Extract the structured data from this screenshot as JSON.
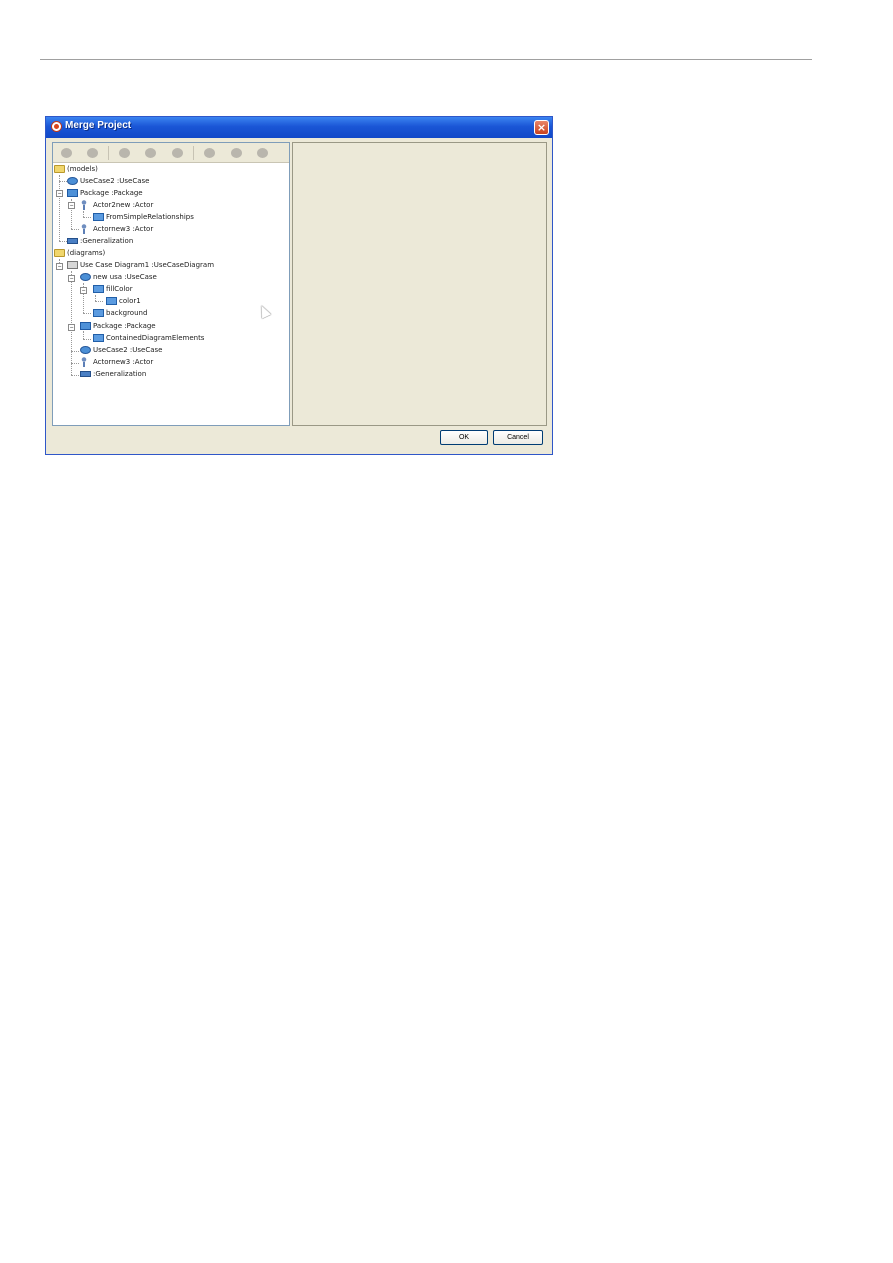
{
  "window": {
    "title": "Merge Project",
    "close_label": "×"
  },
  "toolbar": {
    "icons": [
      "merge-left-icon",
      "merge-right-icon",
      "accept-icon",
      "reject-icon",
      "skip-icon",
      "expand-icon",
      "collapse-icon",
      "refresh-icon"
    ]
  },
  "tree": {
    "nodes": [
      {
        "label": "(models)",
        "icon": "folder-icon"
      },
      {
        "label": "UseCase2 :UseCase",
        "icon": "usecase-icon"
      },
      {
        "label": "Package :Package",
        "icon": "package-icon"
      },
      {
        "label": "Actor2new :Actor",
        "icon": "actor-icon"
      },
      {
        "label": "FromSimpleRelationships",
        "icon": "property-icon"
      },
      {
        "label": "Actornew3 :Actor",
        "icon": "actor-icon"
      },
      {
        "label": ":Generalization",
        "icon": "generalization-icon"
      },
      {
        "label": "(diagrams)",
        "icon": "folder-icon"
      },
      {
        "label": "Use Case Diagram1 :UseCaseDiagram",
        "icon": "diagram-icon"
      },
      {
        "label": "new usa :UseCase",
        "icon": "usecase-icon"
      },
      {
        "label": "fillColor",
        "icon": "property-icon"
      },
      {
        "label": "color1",
        "icon": "property-icon"
      },
      {
        "label": "background",
        "icon": "property-icon"
      },
      {
        "label": "Package :Package",
        "icon": "package-icon"
      },
      {
        "label": "ContainedDiagramElements",
        "icon": "property-icon"
      },
      {
        "label": "UseCase2 :UseCase",
        "icon": "usecase-icon"
      },
      {
        "label": "Actornew3 :Actor",
        "icon": "actor-icon"
      },
      {
        "label": ":Generalization",
        "icon": "generalization-icon"
      }
    ],
    "expanders": [
      "−",
      "−",
      "−",
      "−",
      "−",
      "−"
    ]
  },
  "buttons": {
    "ok": "OK",
    "cancel": "Cancel"
  },
  "colors": {
    "titlebar": "#1a56d6",
    "dialog_bg": "#ece9d8",
    "tree_bg": "#ffffff"
  }
}
